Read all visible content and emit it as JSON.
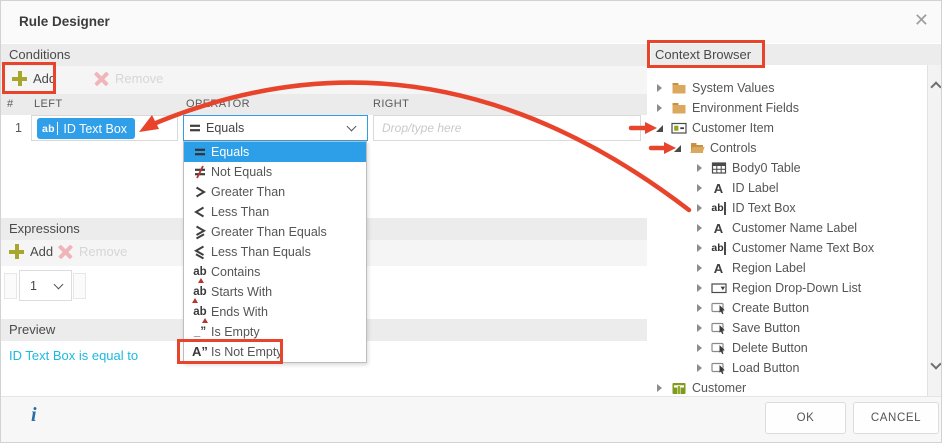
{
  "colors": {
    "annotation_red": "#E8432B",
    "accent_blue": "#2D9FE8",
    "preview_cyan": "#1CB9DF",
    "add_plus_green": "#A6A72C",
    "folder_tan": "#DCA85E",
    "smartobject_green": "#7F9A1E"
  },
  "dialog": {
    "title": "Rule Designer",
    "close_icon": "✕"
  },
  "conditions": {
    "header": "Conditions",
    "toolbar": {
      "add_label": "Add",
      "remove_label": "Remove"
    },
    "table": {
      "columns": [
        "#",
        "LEFT",
        "OPERATOR",
        "RIGHT"
      ],
      "row": {
        "number": "1",
        "left_chip": "ID Text Box",
        "left_chip_icon": "textbox-icon",
        "operator": "Equals",
        "right_placeholder": "Drop/type here"
      }
    }
  },
  "operator_dropdown": {
    "items": [
      {
        "label": "Equals",
        "icon": "equals-icon",
        "selected": true
      },
      {
        "label": "Not Equals",
        "icon": "not-equals-icon"
      },
      {
        "label": "Greater Than",
        "icon": "greater-than-icon"
      },
      {
        "label": "Less Than",
        "icon": "less-than-icon"
      },
      {
        "label": "Greater Than Equals",
        "icon": "greater-than-equals-icon"
      },
      {
        "label": "Less Than Equals",
        "icon": "less-than-equals-icon"
      },
      {
        "label": "Contains",
        "icon": "contains-icon"
      },
      {
        "label": "Starts With",
        "icon": "starts-with-icon"
      },
      {
        "label": "Ends With",
        "icon": "ends-with-icon"
      },
      {
        "label": "Is Empty",
        "icon": "is-empty-icon"
      },
      {
        "label": "Is Not Empty",
        "icon": "is-not-empty-icon",
        "annotated": true
      }
    ]
  },
  "expressions": {
    "header": "Expressions",
    "toolbar": {
      "add_label": "Add",
      "remove_label": "Remove"
    },
    "index_value": "1"
  },
  "preview": {
    "header": "Preview",
    "text": "ID Text Box is equal to"
  },
  "context_browser": {
    "title": "Context Browser",
    "items": [
      {
        "label": "System Values",
        "icon": "folder-closed-icon",
        "level": 0,
        "state": "collapsed"
      },
      {
        "label": "Environment Fields",
        "icon": "folder-closed-icon",
        "level": 0,
        "state": "collapsed"
      },
      {
        "label": "Customer Item",
        "icon": "item-icon",
        "level": 0,
        "state": "expanded",
        "annotated": true
      },
      {
        "label": "Controls",
        "icon": "folder-open-icon",
        "level": 1,
        "state": "expanded",
        "annotated": true
      },
      {
        "label": "Body0 Table",
        "icon": "table-icon",
        "level": 2,
        "state": "collapsed"
      },
      {
        "label": "ID Label",
        "icon": "label-icon",
        "level": 2,
        "state": "collapsed"
      },
      {
        "label": "ID Text Box",
        "icon": "textbox-icon",
        "level": 2,
        "state": "collapsed"
      },
      {
        "label": "Customer Name Label",
        "icon": "label-icon",
        "level": 2,
        "state": "collapsed"
      },
      {
        "label": "Customer Name Text Box",
        "icon": "textbox-icon",
        "level": 2,
        "state": "collapsed"
      },
      {
        "label": "Region Label",
        "icon": "label-icon",
        "level": 2,
        "state": "collapsed"
      },
      {
        "label": "Region Drop-Down List",
        "icon": "dropdown-icon",
        "level": 2,
        "state": "collapsed"
      },
      {
        "label": "Create Button",
        "icon": "button-icon",
        "level": 2,
        "state": "collapsed"
      },
      {
        "label": "Save Button",
        "icon": "button-icon",
        "level": 2,
        "state": "collapsed"
      },
      {
        "label": "Delete Button",
        "icon": "button-icon",
        "level": 2,
        "state": "collapsed"
      },
      {
        "label": "Load Button",
        "icon": "button-icon",
        "level": 2,
        "state": "collapsed"
      },
      {
        "label": "Customer",
        "icon": "smartobject-icon",
        "level": 0,
        "state": "collapsed"
      }
    ]
  },
  "footer": {
    "info_icon": "i",
    "ok_label": "OK",
    "cancel_label": "CANCEL"
  },
  "annotations": {
    "boxed": [
      "Add",
      "Context Browser",
      "Is Not Empty"
    ],
    "arrow_targets": [
      "Customer Item",
      "Controls"
    ],
    "curve": {
      "from": "ID Text Box (tree item)",
      "to": "ID Text Box (condition chip)"
    }
  }
}
